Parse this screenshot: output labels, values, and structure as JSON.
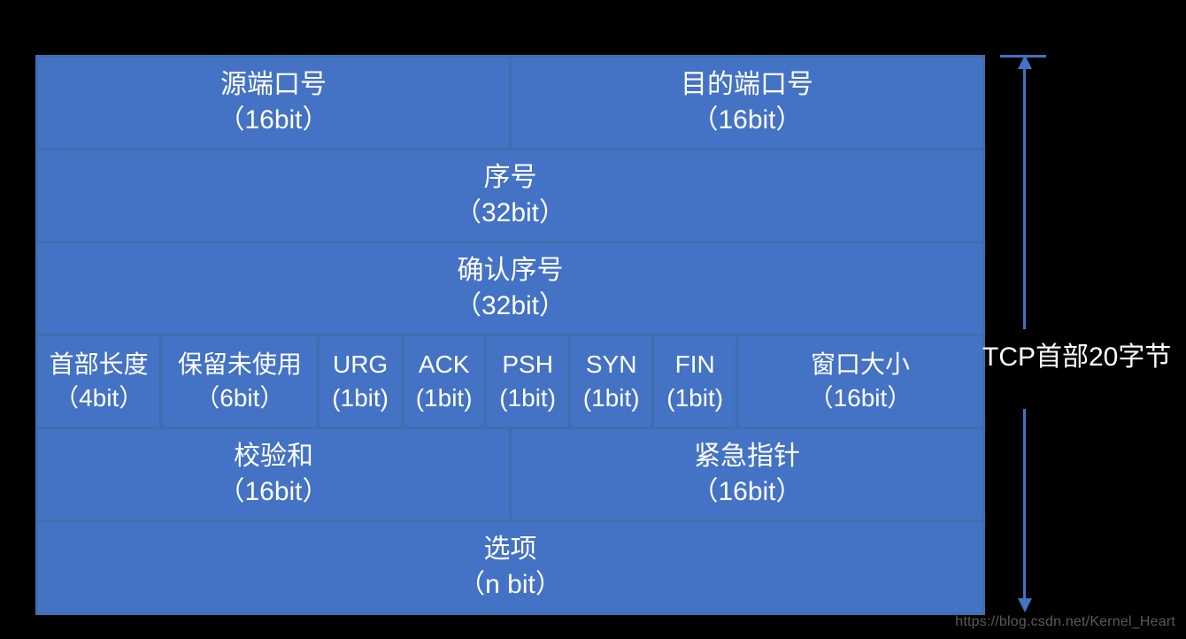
{
  "diagram": {
    "rows": [
      {
        "cells": [
          {
            "label": "源端口号",
            "bits": "（16bit）",
            "grow": "g16"
          },
          {
            "label": "目的端口号",
            "bits": "（16bit）",
            "grow": "g16"
          }
        ]
      },
      {
        "cells": [
          {
            "label": "序号",
            "bits": "（32bit）",
            "grow": "g32"
          }
        ]
      },
      {
        "cells": [
          {
            "label": "确认序号",
            "bits": "（32bit）",
            "grow": "g32"
          }
        ]
      },
      {
        "cells": [
          {
            "label": "首部长度",
            "bits": "（4bit）",
            "grow": "g4",
            "small": true
          },
          {
            "label": "保留未使用",
            "bits": "（6bit）",
            "grow": "g6",
            "small": true
          },
          {
            "label": "URG",
            "bits": "(1bit)",
            "grow": "g1",
            "small": true
          },
          {
            "label": "ACK",
            "bits": "(1bit)",
            "grow": "g1",
            "small": true
          },
          {
            "label": "PSH",
            "bits": "(1bit)",
            "grow": "g1",
            "small": true
          },
          {
            "label": "SYN",
            "bits": "(1bit)",
            "grow": "g1",
            "small": true
          },
          {
            "label": "FIN",
            "bits": "(1bit)",
            "grow": "g1",
            "small": true
          },
          {
            "label": "窗口大小",
            "bits": "（16bit）",
            "grow": "gw",
            "small": true
          }
        ]
      },
      {
        "cells": [
          {
            "label": "校验和",
            "bits": "（16bit）",
            "grow": "g16"
          },
          {
            "label": "紧急指针",
            "bits": "（16bit）",
            "grow": "g16"
          }
        ]
      },
      {
        "cells": [
          {
            "label": "选项",
            "bits": "（n bit）",
            "grow": "g32"
          }
        ]
      }
    ],
    "side_label": "TCP首部20字节",
    "watermark": "https://blog.csdn.net/Kernel_Heart"
  }
}
